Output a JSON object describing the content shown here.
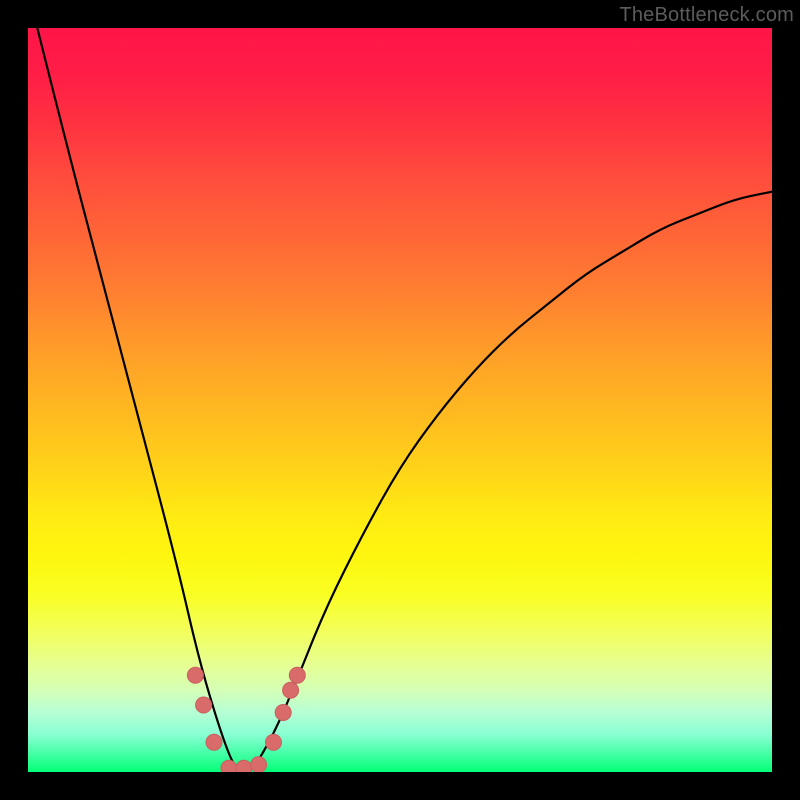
{
  "watermark": "TheBottleneck.com",
  "colors": {
    "frame": "#000000",
    "curve_stroke": "#000000",
    "marker_fill": "#d96b6b",
    "marker_stroke": "#c95f5f",
    "gradient_top": "#ff1549",
    "gradient_bottom": "#04ff78"
  },
  "chart_data": {
    "type": "line",
    "title": "",
    "xlabel": "",
    "ylabel": "",
    "xlim": [
      0,
      100
    ],
    "ylim": [
      0,
      100
    ],
    "description": "V-shaped bottleneck curve over red-to-green gradient. Minimum (green zone) near x≈28. Curve value ~100 at x=0, drops steeply to ~0 at x≈28, rises with decreasing slope toward ~78 at x=100.",
    "series": [
      {
        "name": "bottleneck-curve",
        "x": [
          0,
          5,
          10,
          15,
          20,
          23,
          26,
          28,
          30,
          33,
          36,
          40,
          45,
          50,
          55,
          60,
          65,
          70,
          75,
          80,
          85,
          90,
          95,
          100
        ],
        "values": [
          105,
          85,
          66,
          47,
          28,
          15,
          5,
          0,
          0,
          5,
          12,
          22,
          32,
          41,
          48,
          54,
          59,
          63,
          67,
          70,
          73,
          75,
          77,
          78
        ]
      }
    ],
    "markers": [
      {
        "x": 22.5,
        "y": 13
      },
      {
        "x": 23.6,
        "y": 9
      },
      {
        "x": 25.0,
        "y": 4
      },
      {
        "x": 27.0,
        "y": 0.5
      },
      {
        "x": 29.0,
        "y": 0.5
      },
      {
        "x": 31.0,
        "y": 1
      },
      {
        "x": 33.0,
        "y": 4
      },
      {
        "x": 34.3,
        "y": 8
      },
      {
        "x": 35.3,
        "y": 11
      },
      {
        "x": 36.2,
        "y": 13
      }
    ]
  }
}
